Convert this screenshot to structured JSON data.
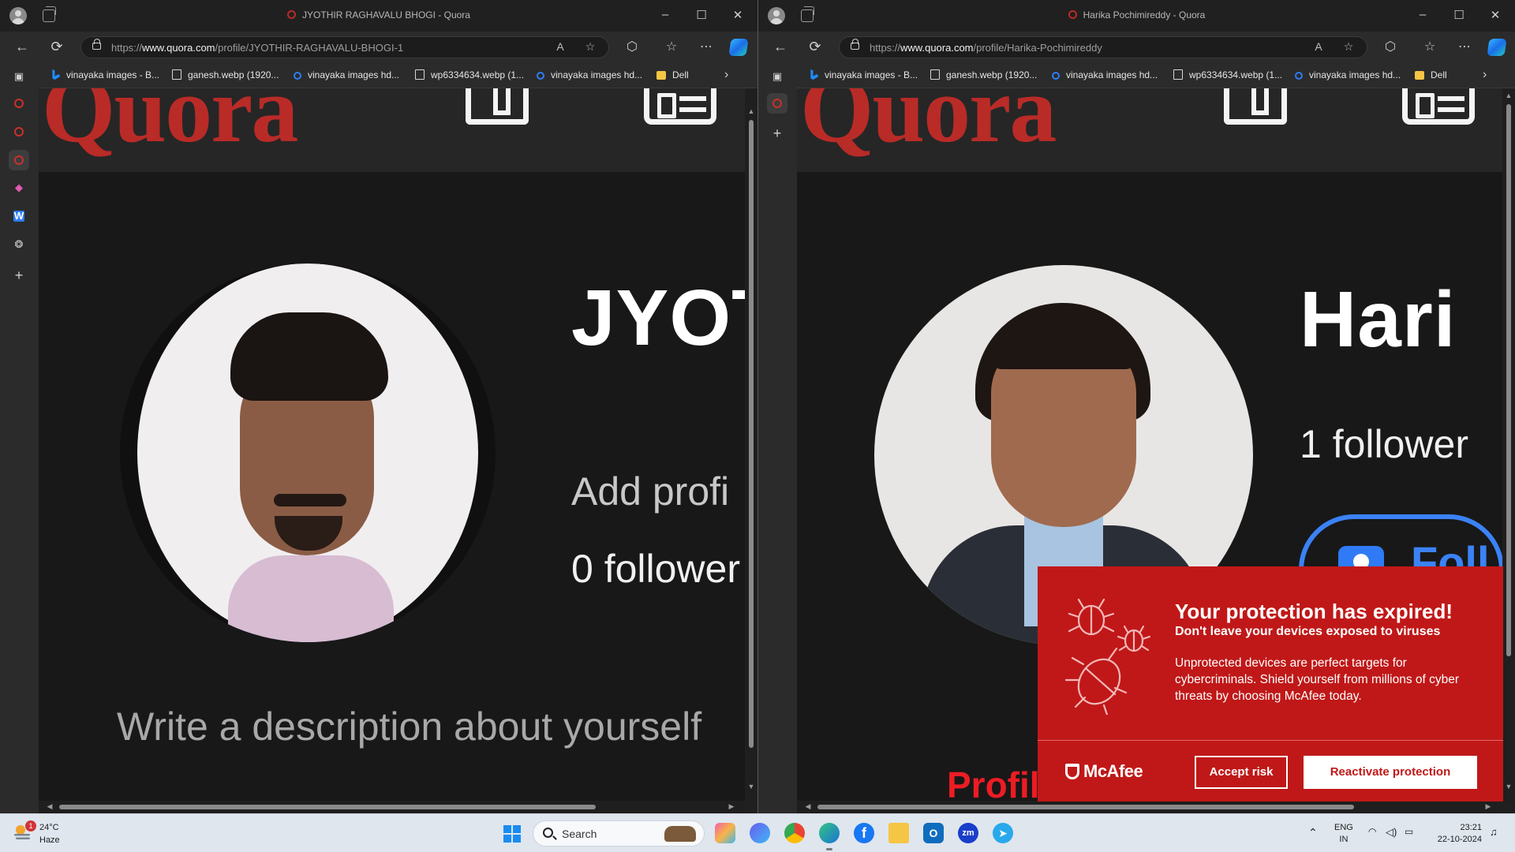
{
  "left_window": {
    "title": "JYOTHIR RAGHAVALU BHOGI - Quora",
    "url_prefix": "https://",
    "url_domain": "www.quora.com",
    "url_path": "/profile/JYOTHIR-RAGHAVALU-BHOGI-1",
    "profile": {
      "name": "JYOT",
      "credential_placeholder": "Add profi",
      "followers": "0 follower",
      "description_placeholder": "Write a description about yourself"
    }
  },
  "right_window": {
    "title": "Harika Pochimireddy - Quora",
    "url_prefix": "https://",
    "url_domain": "www.quora.com",
    "url_path": "/profile/Harika-Pochimireddy",
    "profile": {
      "name": "Hari",
      "followers": "1 follower",
      "follow_label": "Foll",
      "profile_tab": "Profile"
    }
  },
  "site": {
    "logo": "Quora",
    "brand_color": "#b92b27"
  },
  "favorites": [
    {
      "label": "vinayaka images - B...",
      "icon": "bing-icon"
    },
    {
      "label": "ganesh.webp (1920...",
      "icon": "page-icon"
    },
    {
      "label": "vinayaka images hd...",
      "icon": "search-icon"
    },
    {
      "label": "wp6334634.webp (1...",
      "icon": "page-icon"
    },
    {
      "label": "vinayaka images hd...",
      "icon": "search-icon"
    },
    {
      "label": "Dell",
      "icon": "folder-icon"
    }
  ],
  "window_controls": {
    "minimize": "–",
    "maximize": "☐",
    "close": "✕"
  },
  "mcafee_popup": {
    "title": "Your protection has expired!",
    "subtitle": "Don't leave your devices exposed to viruses",
    "body": "Unprotected devices are perfect targets for cybercriminals. Shield yourself from millions of cyber threats by choosing McAfee today.",
    "brand": "McAfee",
    "accept_label": "Accept risk",
    "reactivate_label": "Reactivate protection",
    "color": "#c01818"
  },
  "taskbar": {
    "temperature": "24°C",
    "condition": "Haze",
    "notification_count": "1",
    "search_placeholder": "Search",
    "lang_line1": "ENG",
    "lang_line2": "IN",
    "time": "23:21",
    "date": "22-10-2024"
  }
}
